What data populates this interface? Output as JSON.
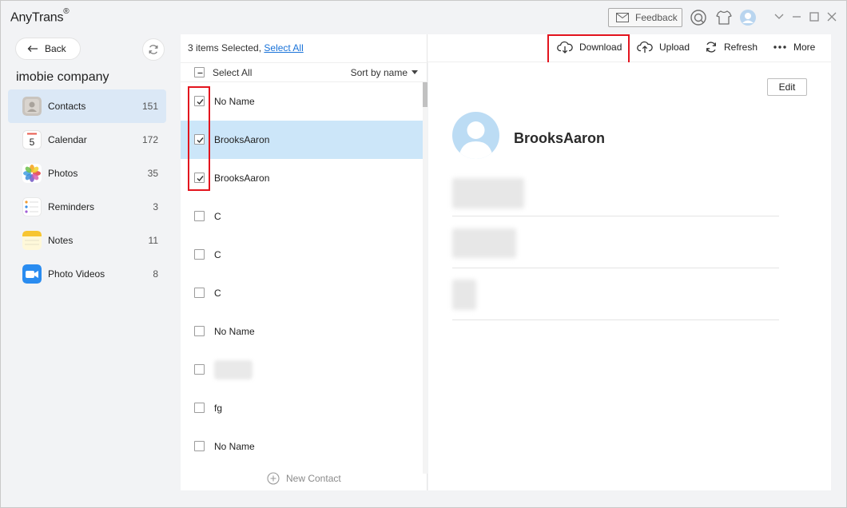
{
  "window": {
    "app_title": "AnyTrans",
    "app_title_mark": "®",
    "feedback_label": "Feedback"
  },
  "sidebar": {
    "back_label": "Back",
    "device_name": "imobie company",
    "items": [
      {
        "label": "Contacts",
        "count": "151",
        "icon": "contacts-icon",
        "active": true
      },
      {
        "label": "Calendar",
        "count": "172",
        "icon": "calendar-icon",
        "active": false
      },
      {
        "label": "Photos",
        "count": "35",
        "icon": "photos-icon",
        "active": false
      },
      {
        "label": "Reminders",
        "count": "3",
        "icon": "reminders-icon",
        "active": false
      },
      {
        "label": "Notes",
        "count": "11",
        "icon": "notes-icon",
        "active": false
      },
      {
        "label": "Photo Videos",
        "count": "8",
        "icon": "photo-videos-icon",
        "active": false
      }
    ],
    "calendar_icon_day": "5"
  },
  "list": {
    "selection_info": "3 items Selected,",
    "select_all_link": "Select All",
    "header_select_all": "Select All",
    "sort_label": "Sort by name",
    "rows": [
      {
        "label": "No Name",
        "checked": true,
        "selected": false
      },
      {
        "label": "BrooksAaron",
        "checked": true,
        "selected": true
      },
      {
        "label": "BrooksAaron",
        "checked": true,
        "selected": false
      },
      {
        "label": "C",
        "checked": false,
        "selected": false
      },
      {
        "label": "C",
        "checked": false,
        "selected": false
      },
      {
        "label": "C",
        "checked": false,
        "selected": false
      },
      {
        "label": "No Name",
        "checked": false,
        "selected": false
      },
      {
        "label": "",
        "checked": false,
        "selected": false,
        "blurred": true
      },
      {
        "label": "fg",
        "checked": false,
        "selected": false
      },
      {
        "label": "No Name",
        "checked": false,
        "selected": false
      }
    ],
    "new_contact_label": "New Contact"
  },
  "toolbar": {
    "download_label": "Download",
    "upload_label": "Upload",
    "refresh_label": "Refresh",
    "more_label": "More"
  },
  "detail": {
    "edit_label": "Edit",
    "contact_name": "BrooksAaron"
  },
  "colors": {
    "accent": "#1a73d9",
    "selected_row": "#cce6f9",
    "active_nav": "#dbe8f6",
    "highlight_box": "#e3141e"
  }
}
